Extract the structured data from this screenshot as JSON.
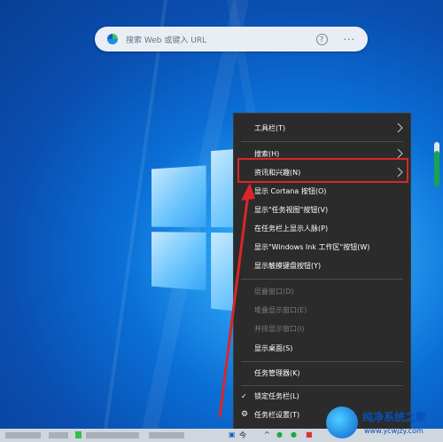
{
  "search": {
    "placeholder": "搜索 Web 或键入 URL",
    "help_glyph": "?",
    "more_glyph": "···"
  },
  "menu": {
    "items": [
      {
        "label": "工具栏(T)",
        "submenu": true,
        "enabled": true
      },
      {
        "label": "搜索(H)",
        "submenu": true,
        "enabled": true
      },
      {
        "label": "资讯和兴趣(N)",
        "submenu": true,
        "enabled": true,
        "highlighted": true
      },
      {
        "label": "显示 Cortana 按钮(O)",
        "submenu": false,
        "enabled": true
      },
      {
        "label": "显示\"任务视图\"按钮(V)",
        "submenu": false,
        "enabled": true
      },
      {
        "label": "在任务栏上显示人脉(P)",
        "submenu": false,
        "enabled": true
      },
      {
        "label": "显示\"Windows Ink 工作区\"按钮(W)",
        "submenu": false,
        "enabled": true
      },
      {
        "label": "显示触摸键盘按钮(Y)",
        "submenu": false,
        "enabled": true
      },
      {
        "label": "层叠窗口(D)",
        "submenu": false,
        "enabled": false
      },
      {
        "label": "堆叠显示窗口(E)",
        "submenu": false,
        "enabled": false
      },
      {
        "label": "并排显示窗口(I)",
        "submenu": false,
        "enabled": false
      },
      {
        "label": "显示桌面(S)",
        "submenu": false,
        "enabled": true
      },
      {
        "label": "任务管理器(K)",
        "submenu": false,
        "enabled": true
      },
      {
        "label": "锁定任务栏(L)",
        "submenu": false,
        "enabled": true,
        "checked": true
      },
      {
        "label": "任务栏设置(T)",
        "submenu": false,
        "enabled": true,
        "icon": "gear-icon"
      }
    ]
  },
  "taskbar": {
    "visible_text": "今",
    "tray_glyph": "^"
  },
  "watermark": {
    "title": "纯净系统之家",
    "url": "www.ycwjzy.com"
  },
  "colors": {
    "menu_bg": "#2b2b2b",
    "highlight_border": "#d9262b",
    "arrow": "#d9262b"
  }
}
